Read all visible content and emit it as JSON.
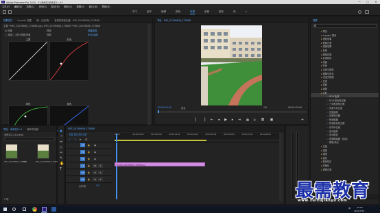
{
  "window": {
    "title": "Adobe Premiere Pro 2020 - E:\\未命名\\未命名11.4 *",
    "app_logo": "Pr",
    "controls": [
      "—",
      "□",
      "✕"
    ]
  },
  "menu": [
    "文件(F)",
    "编辑(E)",
    "剪辑(C)",
    "序列(S)",
    "标记(M)",
    "图形(G)",
    "视图(V)",
    "窗口(W)",
    "帮助(H)"
  ],
  "workspaces": {
    "items": [
      "学习",
      "组件",
      "编辑",
      "颜色",
      "效果",
      "音频",
      "图形",
      "库"
    ],
    "active_index": 4,
    "more": "»"
  },
  "effect_controls": {
    "tabs": [
      "效果控件",
      "Lumetri 范围",
      "源：(无剪辑)",
      "音频剪辑混合器：IMG_20190608_170608"
    ],
    "clip_path": "主要 * IMG_20190608_170608.jpg  ▸  IMG_20190608_170608 * IMG_20190608_170608",
    "rows": [
      "fx  亮度",
      "◯  原始 □ 统计效果/亮度"
    ],
    "curves": [
      "主要",
      "红色",
      "绿色",
      "蓝色"
    ],
    "right_labels": [
      "视频",
      "视频",
      "亮度曲线",
      "RGB 曲线"
    ]
  },
  "program_monitor": {
    "tab": "节目：IMG_20190608_170608",
    "timecode_left": "00:00:00:00",
    "fit": "适合",
    "scale": "1/2",
    "timecode_right": "00:00:05:00",
    "video": {
      "sky": "#eef1f5",
      "lawn": "#3f8f3a",
      "building": "#e8dfc9",
      "path": "#c4745a"
    }
  },
  "project": {
    "tabs": [
      "项目：未命名11.4",
      "媒体浏览器"
    ],
    "path": "未命名11.4.prproj",
    "items": [
      {
        "name": "IMG_20190608_170608",
        "duration": "5:00"
      },
      {
        "name": "IMG_20190608_170608",
        "duration": "5:00"
      }
    ],
    "item_count": "2 项"
  },
  "timeline": {
    "tab": "IMG_20190608_170608",
    "timecode": "00:00:00:00",
    "ruler": [
      "00:00",
      "00:00:01:00",
      "00:00:02:00",
      "00:00:03:00",
      "00:00:04:00",
      "00:00:05:00",
      "00:00:06:00",
      "00:00:07:00",
      "00:00:08:00"
    ],
    "tracks": [
      {
        "label": "V3"
      },
      {
        "label": "V2"
      },
      {
        "label": "V1"
      },
      {
        "label": "A1",
        "btns": [
          "M",
          "S"
        ]
      },
      {
        "label": "A2",
        "btns": [
          "M",
          "S"
        ]
      },
      {
        "label": "A3",
        "btns": [
          "M",
          "S"
        ]
      }
    ],
    "master": "主声道",
    "master_value": "0.0",
    "clip_label": "fx  IMG_20190608_170608.jpg",
    "clip_color": "#d18ee0"
  },
  "effects": {
    "title": "效果",
    "search_placeholder": "",
    "tree": [
      {
        "t": "预设",
        "k": "folder"
      },
      {
        "t": "Lumetri 预设",
        "k": "folder"
      },
      {
        "t": "音频效果",
        "k": "folder"
      },
      {
        "t": "音频过渡",
        "k": "folder"
      },
      {
        "t": "视频效果",
        "k": "folder"
      },
      {
        "t": "变换",
        "k": "folder"
      },
      {
        "t": "图像控制",
        "k": "folder"
      },
      {
        "t": "实用程序",
        "k": "folder"
      },
      {
        "t": "扭曲",
        "k": "folder"
      },
      {
        "t": "时间",
        "k": "folder"
      },
      {
        "t": "杂色与颗粒",
        "k": "folder"
      },
      {
        "t": "模糊与锐化",
        "k": "folder"
      },
      {
        "t": "沉浸式视频",
        "k": "folder"
      },
      {
        "t": "生成",
        "k": "folder"
      },
      {
        "t": "视频",
        "k": "folder"
      },
      {
        "t": "调整",
        "k": "folder"
      },
      {
        "t": "过时",
        "k": "folder"
      },
      {
        "t": "RGB 曲线",
        "k": "fx"
      },
      {
        "t": "RGB 颜色校正器",
        "k": "fx"
      },
      {
        "t": "三向颜色校正器",
        "k": "fx"
      },
      {
        "t": "亮度与对比度",
        "k": "fx"
      },
      {
        "t": "亮度曲线",
        "k": "fx"
      },
      {
        "t": "亮度校正器",
        "k": "fx"
      },
      {
        "t": "快速模糊",
        "k": "fx"
      },
      {
        "t": "快速颜色校正器",
        "k": "fx"
      },
      {
        "t": "自动对比度",
        "k": "fx"
      },
      {
        "t": "自动色阶",
        "k": "fx"
      },
      {
        "t": "自动颜色",
        "k": "fx"
      },
      {
        "t": "视频限幅器（旧版）",
        "k": "fx"
      },
      {
        "t": "阴影/高光",
        "k": "fx"
      },
      {
        "t": "过渡",
        "k": "folder"
      },
      {
        "t": "透视",
        "k": "folder"
      },
      {
        "t": "通道",
        "k": "folder"
      },
      {
        "t": "键控",
        "k": "folder"
      },
      {
        "t": "颜色校正",
        "k": "folder"
      },
      {
        "t": "风格化",
        "k": "folder"
      },
      {
        "t": "视频过渡",
        "k": "folder"
      }
    ],
    "bottom_label": "基本图形"
  },
  "taskbar": {
    "time": "15:03",
    "date": "2021/7/14",
    "lang": "中"
  },
  "watermark": {
    "title": "最需教育",
    "url": "www.zuixujiaoyu.com"
  }
}
